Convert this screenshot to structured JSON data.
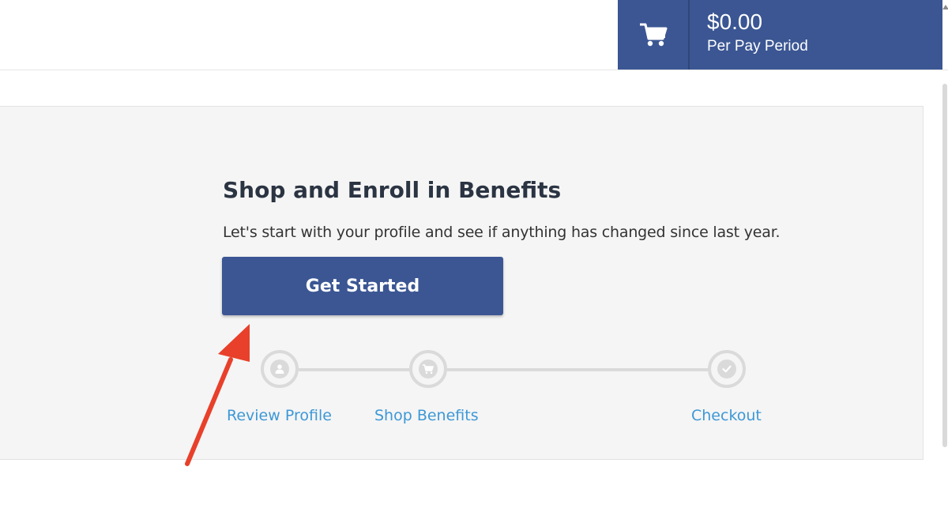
{
  "cart": {
    "icon": "shopping-cart-icon",
    "amount": "$0.00",
    "period": "Per Pay Period"
  },
  "main": {
    "title": "Shop and Enroll in Benefits",
    "subtitle": "Let's start with your profile and see if anything has changed since last year.",
    "cta_label": "Get Started"
  },
  "steps": [
    {
      "label": "Review Profile",
      "icon": "user-icon"
    },
    {
      "label": "Shop Benefits",
      "icon": "shopping-cart-icon"
    },
    {
      "label": "Checkout",
      "icon": "checkmark-icon"
    }
  ],
  "colors": {
    "brand": "#3b5693",
    "link": "#3d98d6",
    "annotation": "#e8402a"
  }
}
